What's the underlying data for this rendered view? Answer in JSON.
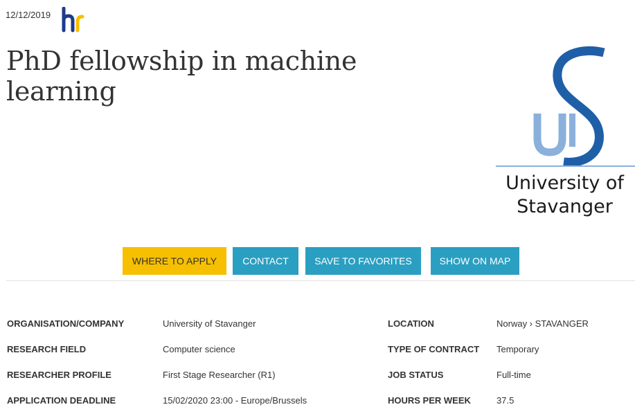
{
  "header": {
    "date": "12/12/2019",
    "title": "PhD fellowship in machine learning"
  },
  "logos": {
    "hr": "hr-excellence-logo",
    "university_name_line1": "University of",
    "university_name_line2": "Stavanger"
  },
  "actions": {
    "where_to_apply": "WHERE TO APPLY",
    "contact": "CONTACT",
    "save_to_favorites": "SAVE TO FAVORITES",
    "show_on_map": "SHOW ON MAP"
  },
  "details": [
    {
      "label": "ORGANISATION/COMPANY",
      "value": "University of Stavanger",
      "label2": "LOCATION",
      "value2": "Norway › STAVANGER"
    },
    {
      "label": "RESEARCH FIELD",
      "value": "Computer science",
      "label2": "TYPE OF CONTRACT",
      "value2": "Temporary"
    },
    {
      "label": "RESEARCHER PROFILE",
      "value": "First Stage Researcher (R1)",
      "label2": "JOB STATUS",
      "value2": "Full-time"
    },
    {
      "label": "APPLICATION DEADLINE",
      "value": "15/02/2020 23:00 - Europe/Brussels",
      "label2": "HOURS PER WEEK",
      "value2": "37.5"
    }
  ],
  "colors": {
    "apply_button": "#f6bf00",
    "primary_button": "#2a9fc1",
    "hr_logo": "#1d3b8c",
    "uis_dark_blue": "#1f5fa8",
    "uis_light_blue": "#8bb0dc"
  }
}
